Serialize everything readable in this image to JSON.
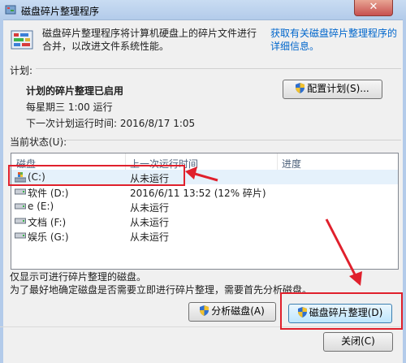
{
  "window": {
    "title": "磁盘碎片整理程序",
    "close_glyph": "✕"
  },
  "intro": {
    "description": "磁盘碎片整理程序将计算机硬盘上的碎片文件进行合并，以改进文件系统性能。",
    "link": "获取有关磁盘碎片整理程序的详细信息。"
  },
  "schedule": {
    "section_label": "计划:",
    "status": "计划的碎片整理已启用",
    "frequency": "每星期三  1:00 运行",
    "next_run": "下一次计划运行时间: 2016/8/17 1:05",
    "configure_button": "配置计划(S)..."
  },
  "current_status": {
    "section_label": "当前状态(U):",
    "columns": [
      "磁盘",
      "上一次运行时间",
      "进度"
    ],
    "disks": [
      {
        "name": "(C:)",
        "last_run": "从未运行",
        "progress": "",
        "icon": "system-drive-icon"
      },
      {
        "name": "软件 (D:)",
        "last_run": "2016/6/11 13:52 (12% 碎片)",
        "progress": "",
        "icon": "drive-icon"
      },
      {
        "name": "e (E:)",
        "last_run": "从未运行",
        "progress": "",
        "icon": "drive-icon"
      },
      {
        "name": "文档 (F:)",
        "last_run": "从未运行",
        "progress": "",
        "icon": "drive-icon"
      },
      {
        "name": "娱乐 (G:)",
        "last_run": "从未运行",
        "progress": "",
        "icon": "drive-icon"
      }
    ]
  },
  "notes": {
    "line1": "仅显示可进行碎片整理的磁盘。",
    "line2": "为了最好地确定磁盘是否需要立即进行碎片整理，需要首先分析磁盘。"
  },
  "actions": {
    "analyze_button": "分析磁盘(A)",
    "defrag_button": "磁盘碎片整理(D)",
    "close_button": "关闭(C)"
  },
  "colors": {
    "annotation_red": "#e0202c",
    "selection": "#e5f1fb",
    "link": "#0066cc"
  }
}
